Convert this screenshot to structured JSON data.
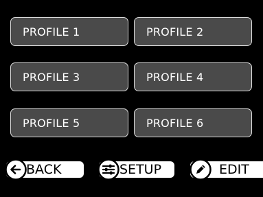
{
  "profiles": [
    {
      "label": "PROFILE 1"
    },
    {
      "label": "PROFILE 2"
    },
    {
      "label": "PROFILE 3"
    },
    {
      "label": "PROFILE 4"
    },
    {
      "label": "PROFILE 5"
    },
    {
      "label": "PROFILE 6"
    }
  ],
  "nav": {
    "back_label": "BACK",
    "setup_label": "SETUP",
    "edit_label": "EDIT"
  },
  "icons": {
    "back": "arrow-left-circle-icon",
    "setup": "sliders-circle-icon",
    "edit": "pencil-circle-icon"
  },
  "colors": {
    "background": "#000000",
    "button_fill": "#4a4a4a",
    "button_border": "#dcdcdc",
    "button_text": "#ffffff",
    "nav_fill": "#ffffff",
    "nav_text": "#000000"
  }
}
